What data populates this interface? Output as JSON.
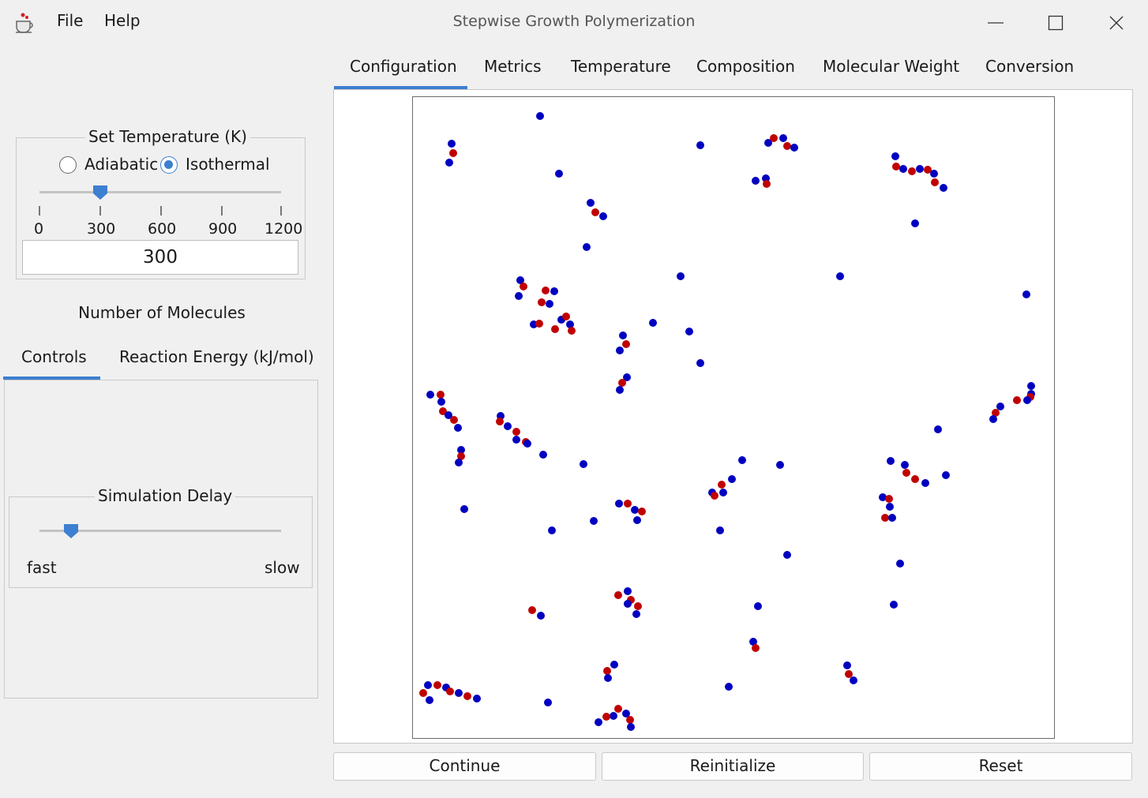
{
  "window": {
    "title": "Stepwise Growth Polymerization",
    "menu": [
      "File",
      "Help"
    ]
  },
  "main_tabs": [
    {
      "label": "Configuration",
      "selected": true
    },
    {
      "label": "Metrics",
      "selected": false
    },
    {
      "label": "Temperature",
      "selected": false
    },
    {
      "label": "Composition",
      "selected": false
    },
    {
      "label": "Molecular Weight",
      "selected": false
    },
    {
      "label": "Conversion",
      "selected": false
    }
  ],
  "temperature": {
    "group_title": "Set Temperature (K)",
    "modes": [
      {
        "label": "Adiabatic",
        "selected": false
      },
      {
        "label": "Isothermal",
        "selected": true
      }
    ],
    "slider": {
      "min": 0,
      "max": 1200,
      "value": 300,
      "tick_labels": [
        "0",
        "300",
        "600",
        "900",
        "1200"
      ]
    },
    "input_value": "300"
  },
  "molecules_label": "Number of Molecules",
  "left_tabs": [
    {
      "label": "Controls",
      "selected": true
    },
    {
      "label": "Reaction Energy (kJ/mol)",
      "selected": false
    }
  ],
  "simulation_delay": {
    "group_title": "Simulation Delay",
    "slider_fraction": 0.13,
    "min_label": "fast",
    "max_label": "slow"
  },
  "buttons": {
    "continue": "Continue",
    "reinitialize": "Reinitialize",
    "reset": "Reset"
  },
  "colors": {
    "accent": "#3d7fd0",
    "monomer_a": "#0000c0",
    "monomer_b": "#c00000"
  }
}
